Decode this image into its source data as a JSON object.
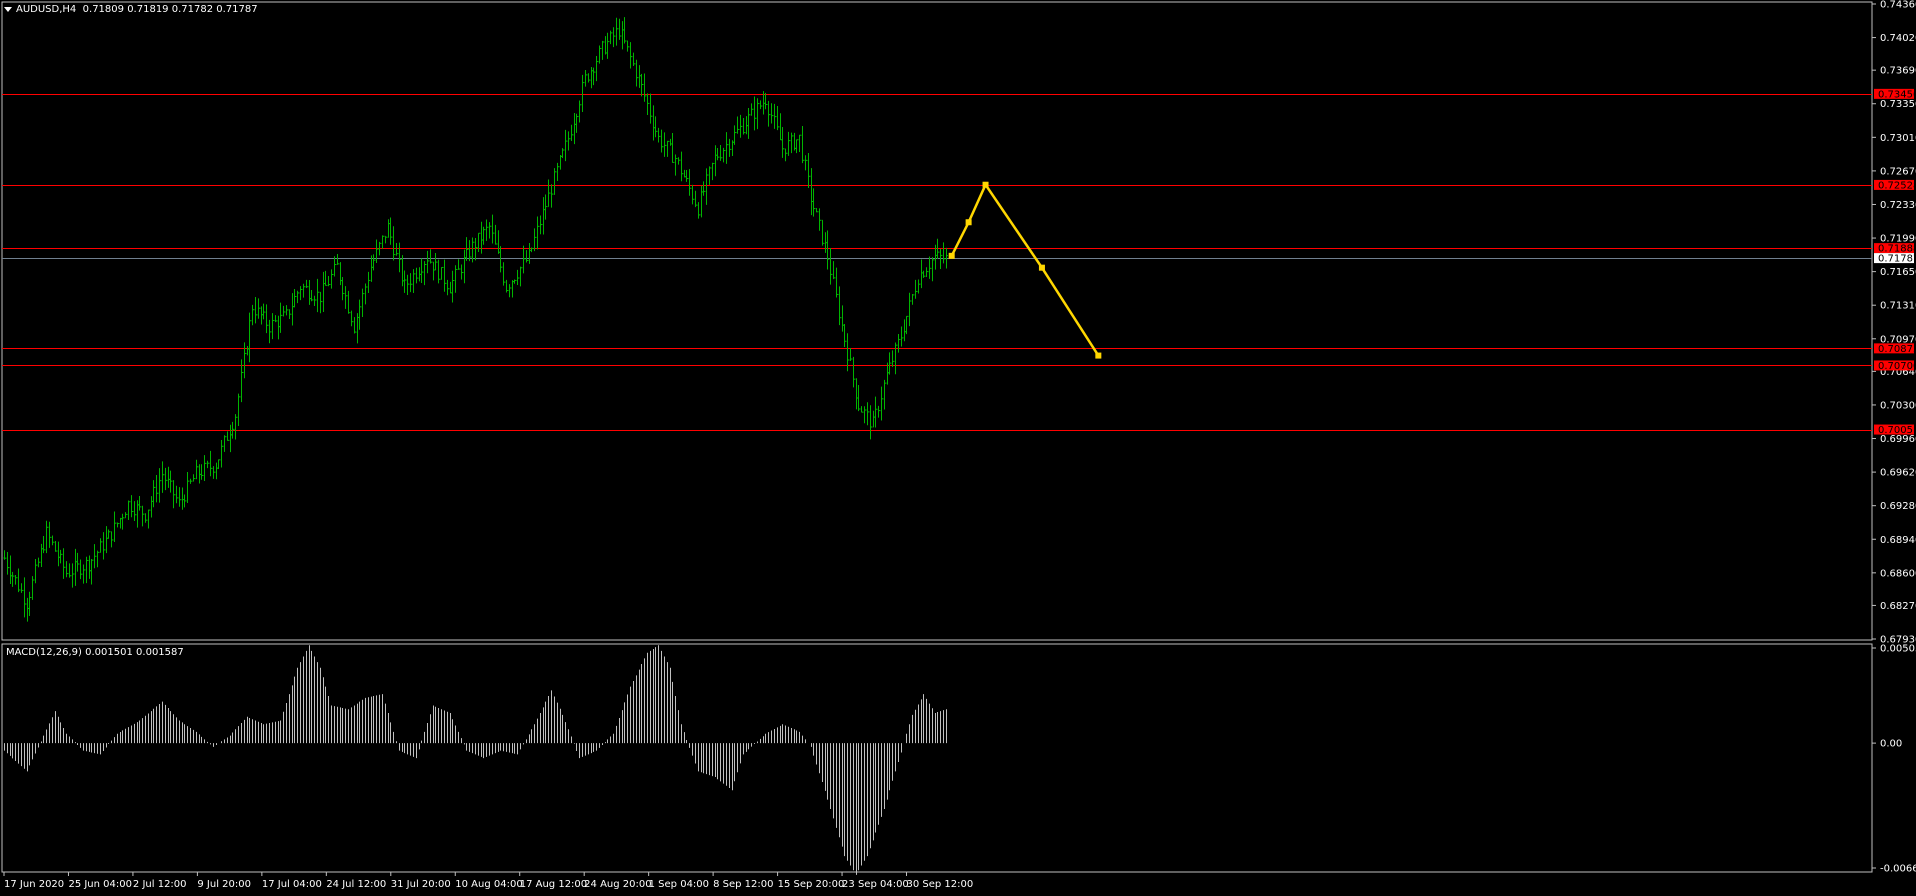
{
  "header": {
    "symbol_info": "AUDUSD,H4",
    "ohlc": "0.71809 0.71819 0.71782 0.71787"
  },
  "macd_header": {
    "title": "MACD(12,26,9)",
    "values": "0.001501 0.001587"
  },
  "colors": {
    "background": "#000000",
    "bull_bar": "#00b400",
    "level_line": "#ff0000",
    "current_price_line": "#708090",
    "forecast": "#ffd700",
    "macd_hist": "#c0c0c0",
    "frame": "#c0c0c0"
  },
  "chart_data": [
    {
      "type": "ohlc",
      "symbol": "AUDUSD",
      "timeframe": "H4",
      "ylim": [
        0.6793,
        0.7436
      ],
      "y_ticks": [
        "0.74360",
        "0.74020",
        "0.73690",
        "0.73350",
        "0.73010",
        "0.72670",
        "0.72330",
        "0.71990",
        "0.71650",
        "0.71310",
        "0.70970",
        "0.70640",
        "0.70300",
        "0.69960",
        "0.69620",
        "0.69280",
        "0.68940",
        "0.68600",
        "0.68270",
        "0.67930"
      ],
      "x_ticks": [
        "17 Jun 2020",
        "25 Jun 04:00",
        "2 Jul 12:00",
        "9 Jul 20:00",
        "17 Jul 04:00",
        "24 Jul 12:00",
        "31 Jul 20:00",
        "10 Aug 04:00",
        "17 Aug 12:00",
        "24 Aug 20:00",
        "1 Sep 04:00",
        "8 Sep 12:00",
        "15 Sep 20:00",
        "23 Sep 04:00",
        "30 Sep 12:00"
      ],
      "price_path": [
        [
          0,
          0.6875
        ],
        [
          8,
          0.683
        ],
        [
          15,
          0.69
        ],
        [
          22,
          0.686
        ],
        [
          30,
          0.687
        ],
        [
          38,
          0.69
        ],
        [
          44,
          0.693
        ],
        [
          50,
          0.692
        ],
        [
          56,
          0.696
        ],
        [
          62,
          0.693
        ],
        [
          68,
          0.696
        ],
        [
          75,
          0.697
        ],
        [
          82,
          0.702
        ],
        [
          88,
          0.713
        ],
        [
          94,
          0.711
        ],
        [
          100,
          0.712
        ],
        [
          105,
          0.715
        ],
        [
          112,
          0.714
        ],
        [
          118,
          0.717
        ],
        [
          124,
          0.711
        ],
        [
          130,
          0.717
        ],
        [
          136,
          0.721
        ],
        [
          142,
          0.715
        ],
        [
          150,
          0.718
        ],
        [
          158,
          0.715
        ],
        [
          166,
          0.719
        ],
        [
          172,
          0.721
        ],
        [
          178,
          0.715
        ],
        [
          186,
          0.718
        ],
        [
          194,
          0.725
        ],
        [
          200,
          0.73
        ],
        [
          206,
          0.736
        ],
        [
          212,
          0.739
        ],
        [
          218,
          0.741
        ],
        [
          225,
          0.736
        ],
        [
          232,
          0.73
        ],
        [
          238,
          0.728
        ],
        [
          246,
          0.723
        ],
        [
          252,
          0.728
        ],
        [
          258,
          0.73
        ],
        [
          264,
          0.732
        ],
        [
          270,
          0.734
        ],
        [
          276,
          0.729
        ],
        [
          282,
          0.73
        ],
        [
          286,
          0.724
        ],
        [
          292,
          0.718
        ],
        [
          297,
          0.711
        ],
        [
          303,
          0.703
        ],
        [
          308,
          0.701
        ],
        [
          313,
          0.706
        ],
        [
          318,
          0.71
        ],
        [
          324,
          0.716
        ],
        [
          330,
          0.718
        ],
        [
          334,
          0.7178
        ]
      ],
      "total_bars": 335,
      "horizontal_levels": [
        {
          "price": 0.7345,
          "label": "0.73450"
        },
        {
          "price": 0.72528,
          "label": "0.72528"
        },
        {
          "price": 0.71888,
          "label": "0.71888"
        },
        {
          "price": 0.70873,
          "label": "0.70873"
        },
        {
          "price": 0.707,
          "label": "0.70700"
        },
        {
          "price": 0.70051,
          "label": "0.70051"
        }
      ],
      "current_price": {
        "price": 0.71787,
        "label": "0.71787"
      },
      "forecast_path": [
        {
          "bar": 335,
          "price": 0.7181
        },
        {
          "bar": 341,
          "price": 0.7215
        },
        {
          "bar": 347,
          "price": 0.7253
        },
        {
          "bar": 367,
          "price": 0.7169
        },
        {
          "bar": 387,
          "price": 0.708
        }
      ]
    },
    {
      "type": "histogram",
      "name": "MACD(12,26,9)",
      "ylim": [
        -0.006632,
        0.005051
      ],
      "y_ticks": [
        "0.005051",
        "0.00",
        "-0.006632"
      ],
      "path": [
        [
          0,
          -0.0004
        ],
        [
          8,
          -0.0015
        ],
        [
          14,
          0.0004
        ],
        [
          18,
          0.0017
        ],
        [
          22,
          0.0005
        ],
        [
          28,
          -0.0004
        ],
        [
          34,
          -0.0006
        ],
        [
          40,
          0.0005
        ],
        [
          48,
          0.0012
        ],
        [
          56,
          0.0022
        ],
        [
          62,
          0.0012
        ],
        [
          68,
          0.0006
        ],
        [
          74,
          -0.0002
        ],
        [
          80,
          0.0004
        ],
        [
          86,
          0.0014
        ],
        [
          92,
          0.001
        ],
        [
          98,
          0.0012
        ],
        [
          104,
          0.004
        ],
        [
          108,
          0.0052
        ],
        [
          112,
          0.004
        ],
        [
          116,
          0.002
        ],
        [
          122,
          0.0018
        ],
        [
          128,
          0.0024
        ],
        [
          134,
          0.0026
        ],
        [
          140,
          -0.0004
        ],
        [
          146,
          -0.0008
        ],
        [
          152,
          0.002
        ],
        [
          158,
          0.0016
        ],
        [
          164,
          -0.0004
        ],
        [
          170,
          -0.0008
        ],
        [
          176,
          -0.0004
        ],
        [
          182,
          -0.0006
        ],
        [
          188,
          0.001
        ],
        [
          194,
          0.0028
        ],
        [
          198,
          0.0015
        ],
        [
          204,
          -0.0008
        ],
        [
          210,
          -0.0004
        ],
        [
          216,
          0.0005
        ],
        [
          222,
          0.003
        ],
        [
          228,
          0.0048
        ],
        [
          232,
          0.0052
        ],
        [
          236,
          0.004
        ],
        [
          240,
          0.001
        ],
        [
          246,
          -0.0015
        ],
        [
          252,
          -0.0018
        ],
        [
          258,
          -0.0025
        ],
        [
          262,
          -0.0006
        ],
        [
          270,
          0.0005
        ],
        [
          276,
          0.001
        ],
        [
          282,
          0.0006
        ],
        [
          286,
          -0.0002
        ],
        [
          292,
          -0.003
        ],
        [
          298,
          -0.006
        ],
        [
          302,
          -0.007
        ],
        [
          306,
          -0.006
        ],
        [
          312,
          -0.0035
        ],
        [
          318,
          -0.0005
        ],
        [
          322,
          0.0015
        ],
        [
          326,
          0.0026
        ],
        [
          330,
          0.0016
        ],
        [
          334,
          0.0018
        ]
      ]
    }
  ]
}
